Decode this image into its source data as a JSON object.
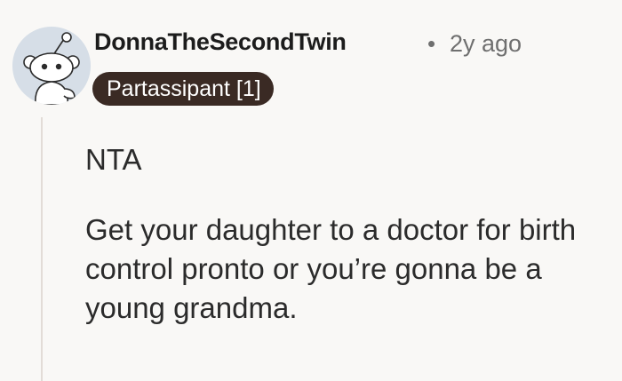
{
  "comment": {
    "author": "DonnaTheSecondTwin",
    "separator": "•",
    "timestamp": "2y ago",
    "flair": "Partassipant [1]",
    "avatar_icon": "snoo-avatar-icon",
    "paragraphs": [
      "NTA",
      "Get your daughter to a doctor for birth control pronto or you’re gonna be a young grandma."
    ]
  },
  "colors": {
    "background": "#f9f8f6",
    "flair_background": "#3a2a24",
    "flair_text": "#ffffff",
    "thread_line": "#e2dcd7",
    "muted_text": "#6f6f6f"
  }
}
